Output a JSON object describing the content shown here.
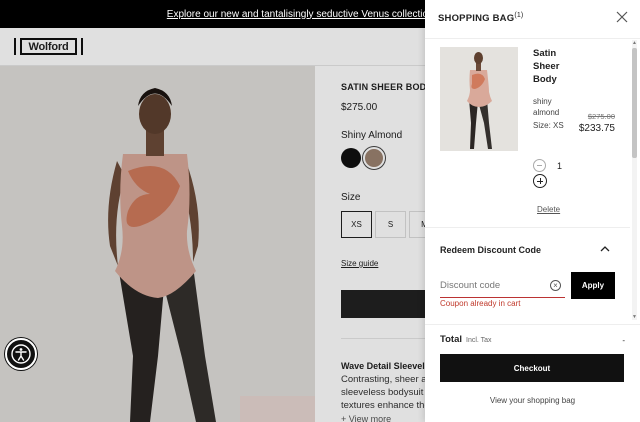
{
  "banner": {
    "text": "Explore our new and tantalisingly seductive Venus collection - S"
  },
  "header": {
    "logo": "Wolford"
  },
  "product": {
    "title": "SATIN SHEER BODY",
    "price": "$275.00",
    "color_label": "Shiny Almond",
    "swatches": [
      {
        "name": "black",
        "color": "#111111"
      },
      {
        "name": "shiny almond",
        "color": "#9b8270",
        "selected": true
      }
    ],
    "size_label": "Size",
    "sizes": [
      "XS",
      "S",
      "M"
    ],
    "selected_size": "XS",
    "size_guide": "Size guide",
    "desc_title": "Wave Detail Sleevele",
    "desc_lines": [
      "Contrasting, sheer ar",
      "sleeveless bodysuit in",
      "textures enhance the"
    ],
    "view_more": "+ View more"
  },
  "bag": {
    "title": "SHOPPING BAG",
    "count": "(1)",
    "item": {
      "name": "Satin Sheer Body",
      "color": "shiny almond",
      "size": "Size: XS",
      "old_price": "$275.00",
      "new_price": "$233.75",
      "quantity": "1",
      "delete": "Delete"
    },
    "discount": {
      "title": "Redeem Discount Code",
      "placeholder": "Discount code",
      "apply": "Apply",
      "error": "Coupon already in cart"
    },
    "total_label": "Total",
    "tax_label": "Incl. Tax",
    "total_value": "-",
    "checkout": "Checkout",
    "view_bag": "View your shopping bag"
  },
  "colors": {
    "accent": "#000000",
    "error": "#c0392b",
    "photo_bg": "#e1dfdb"
  }
}
